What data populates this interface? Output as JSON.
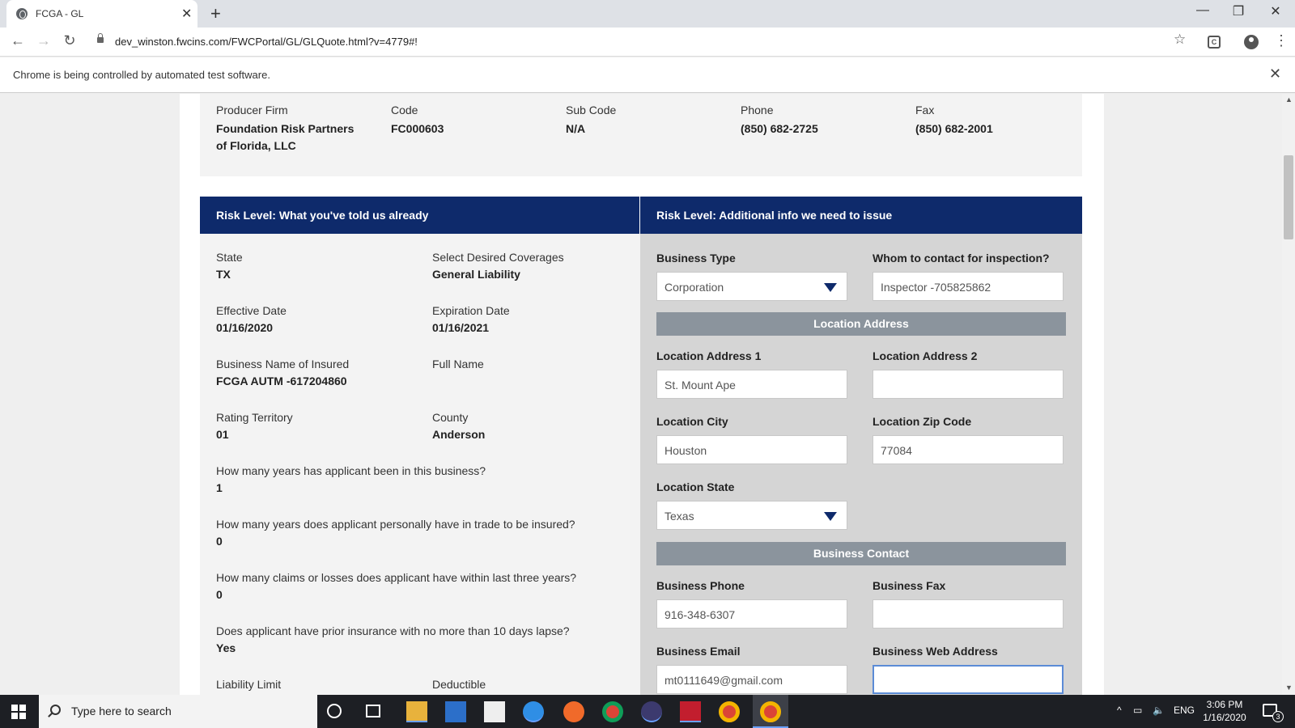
{
  "browser": {
    "tab_title": "FCGA - GL",
    "url": "dev_winston.fwcins.com/FWCPortal/GL/GLQuote.html?v=4779#!",
    "infobar_text": "Chrome is being controlled by automated test software.",
    "extension_letter": "C"
  },
  "producer": {
    "firm_label": "Producer Firm",
    "firm_value": "Foundation Risk Partners of Florida, LLC",
    "code_label": "Code",
    "code_value": "FC000603",
    "subcode_label": "Sub Code",
    "subcode_value": "N/A",
    "phone_label": "Phone",
    "phone_value": "(850) 682-2725",
    "fax_label": "Fax",
    "fax_value": "(850) 682-2001"
  },
  "left_panel": {
    "header": "Risk Level: What you've told us already",
    "state_label": "State",
    "state_value": "TX",
    "coverages_label": "Select Desired Coverages",
    "coverages_value": "General Liability",
    "effective_label": "Effective Date",
    "effective_value": "01/16/2020",
    "expiration_label": "Expiration Date",
    "expiration_value": "01/16/2021",
    "business_name_label": "Business Name of Insured",
    "business_name_value": "FCGA AUTM -617204860",
    "full_name_label": "Full Name",
    "full_name_value": "",
    "territory_label": "Rating Territory",
    "territory_value": "01",
    "county_label": "County",
    "county_value": "Anderson",
    "q_years_business": "How many years has applicant been in this business?",
    "a_years_business": "1",
    "q_years_trade": "How many years does applicant personally have in trade to be insured?",
    "a_years_trade": "0",
    "q_claims": "How many claims or losses does applicant have within last three years?",
    "a_claims": "0",
    "q_prior_insurance": "Does applicant have prior insurance with no more than 10 days lapse?",
    "a_prior_insurance": "Yes",
    "liability_limit_label": "Liability Limit",
    "deductible_label": "Deductible"
  },
  "right_panel": {
    "header": "Risk Level: Additional info we need to issue",
    "business_type_label": "Business Type",
    "business_type_value": "Corporation",
    "inspection_contact_label": "Whom to contact for inspection?",
    "inspection_contact_value": "Inspector -705825862",
    "location_section": "Location Address",
    "address1_label": "Location Address 1",
    "address1_value": "St. Mount Ape",
    "address2_label": "Location Address 2",
    "address2_value": "",
    "city_label": "Location City",
    "city_value": "Houston",
    "zip_label": "Location Zip Code",
    "zip_value": "77084",
    "state_label": "Location State",
    "state_value": "Texas",
    "contact_section": "Business Contact",
    "phone_label": "Business Phone",
    "phone_value": "916-348-6307",
    "fax_label": "Business Fax",
    "fax_value": "",
    "email_label": "Business Email",
    "email_value": "mt0111649@gmail.com",
    "web_label": "Business Web Address",
    "web_value": ""
  },
  "taskbar": {
    "search_placeholder": "Type here to search",
    "language": "ENG",
    "time": "3:06 PM",
    "date": "1/16/2020",
    "notification_count": "3"
  },
  "colors": {
    "panel_header": "#0e2a6b",
    "section_bar": "#8b949d",
    "focus_border": "#5b8bd6"
  }
}
